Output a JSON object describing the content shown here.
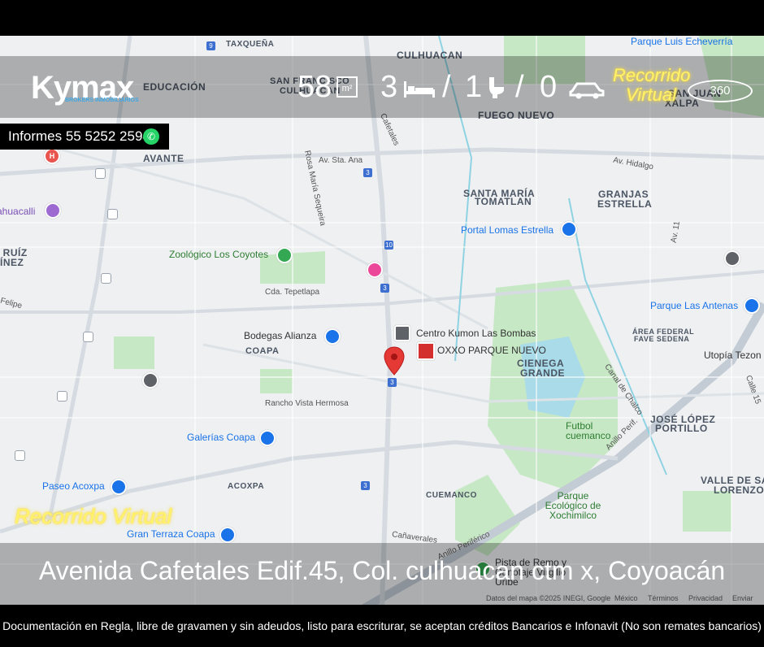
{
  "brand": {
    "name": "Kymax",
    "subtitle": "BROKERS INMOBILIARIOS"
  },
  "stats": {
    "area": "58",
    "area_unit": "m²",
    "bedrooms": "3",
    "bathrooms": "1",
    "parking": "0",
    "separator": "/"
  },
  "tour": {
    "line1": "Recorrido",
    "line2": "Virtual",
    "three_sixty": "360",
    "banner": "Recorrido Virtual"
  },
  "contact": {
    "label": "Informes 55 5252 2594"
  },
  "address": "Avenida Cafetales Edif.45, Col. culhuacan ctm x, Coyoacán",
  "disclaimer": "Documentación en Regla, libre de gravamen y sin adeudos, listo para escriturar, se aceptan créditos Bancarios e Infonavit (No son remates bancarios)",
  "map": {
    "neighborhoods": {
      "culhuacan": "CULHUACAN",
      "san_francisco": "SAN FRANCISCO",
      "culhuacan2": "CULHUACAN",
      "educacion": "EDUCACIÓN",
      "fuego_nuevo": "FUEGO NUEVO",
      "avante": "AVANTE",
      "santa_maria": "SANTA MARÍA",
      "tomatlan": "TOMATLAN",
      "granjas": "GRANJAS",
      "estrella": "ESTRELLA",
      "san_juan": "SAN JUAN",
      "xalpa": "XALPA",
      "ruiz": "O RUÍZ",
      "inez": "ÍNEZ",
      "coapa": "COAPA",
      "cienega": "CIENEGA",
      "grande": "GRANDE",
      "area_federal": "ÁREA FEDERAL",
      "fave_sedena": "FAVE SEDENA",
      "jose_lopez": "JOSÉ LÓPEZ",
      "portillo": "PORTILLO",
      "acoxpa": "ACOXPA",
      "cuemanco": "CUEMANCO",
      "valle_de_s": "VALLE DE SA",
      "lorenzo": "LORENZO",
      "taxquena": "TAXQUEÑA"
    },
    "streets": {
      "av_sta_ana": "Av. Sta. Ana",
      "av_hidalgo": "Av. Hidalgo",
      "rosa_maria": "Rosa María Sequeira",
      "cafetales": "Cafetales",
      "cda_tepetlapa": "Cda. Tepetlapa",
      "rancho_vista": "Rancho Vista Hermosa",
      "calz_chalco": "Canal de Chalco",
      "anillo_periferico": "Anillo Perif.",
      "anillo_periferico2": "Anillo Periférico",
      "canaverales": "Cañaverales",
      "felipe": "Felipe",
      "av11": "Av. 11",
      "calle15": "Calle 15"
    },
    "pois": {
      "echeverria": "Parque Luis Echeverría",
      "ahuacalli": "ahuacalli",
      "portal_lomas": "Portal Lomas Estrella",
      "zoologico": "Zoológico Los Coyotes",
      "parque_antenas": "Parque Las Antenas",
      "bodegas": "Bodegas Alianza",
      "kumon": "Centro Kumon Las Bombas",
      "oxxo": "OXXO PARQUE NUEVO",
      "utopia": "Utopía Tezon",
      "futbol": "Futbol cuemanco",
      "galerias": "Galerías Coapa",
      "paseo_acoxpa": "Paseo Acoxpa",
      "parque_ecologico": "Parque Ecológico de Xochimilco",
      "gran_terraza": "Gran Terraza Coapa",
      "pista": "Pista de Remo y Canotaje Virgilio Uribe"
    },
    "route_numbers": [
      "9",
      "3",
      "10",
      "3",
      "3",
      "3"
    ],
    "attribution": [
      "Datos del mapa ©2025 INEGI, Google",
      "México",
      "Términos",
      "Privacidad",
      "Enviar com"
    ],
    "colors": {
      "park": "#c7e8c4",
      "water": "#a9dbe9",
      "major_road": "#c3cbd4",
      "pin": "#e53935",
      "accent": "#3ea7e6"
    }
  }
}
